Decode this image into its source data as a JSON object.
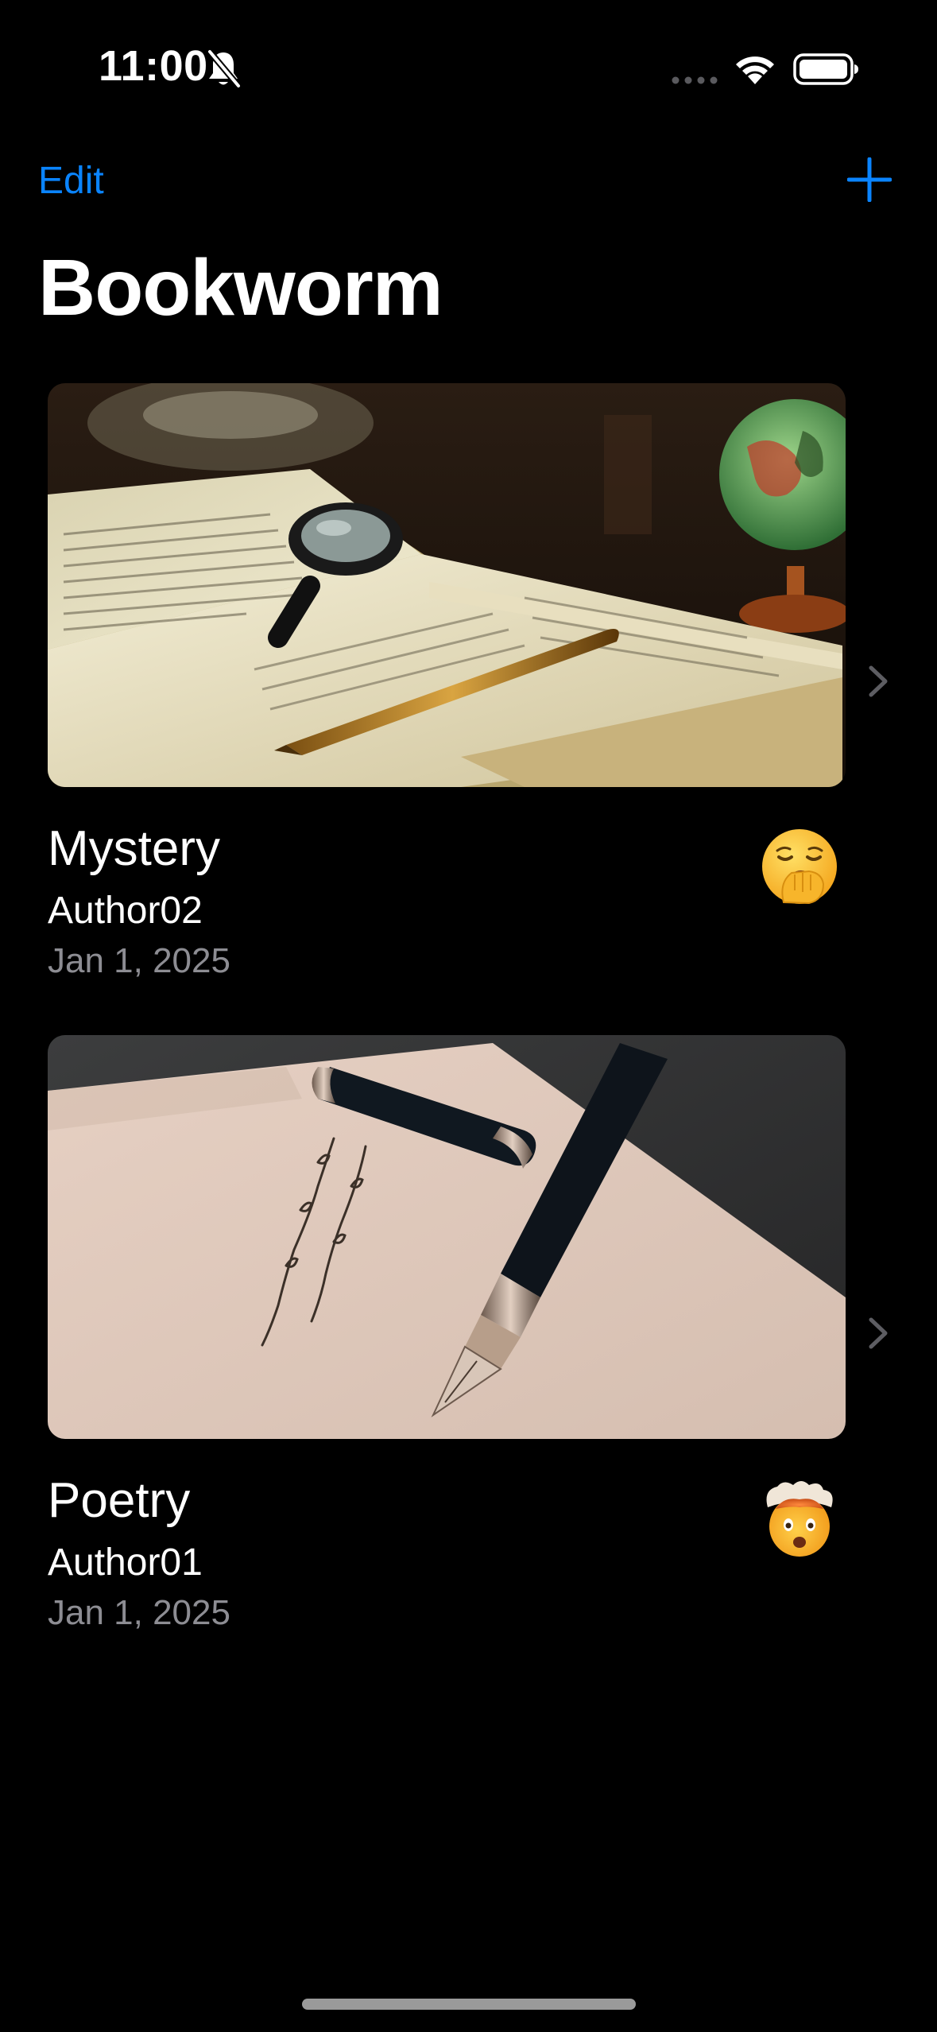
{
  "status_bar": {
    "time": "11:00",
    "icons": [
      "bell-slash-icon",
      "cellular-signal-icon",
      "wifi-icon",
      "battery-icon"
    ]
  },
  "nav": {
    "edit_label": "Edit",
    "add_icon": "plus-icon",
    "title": "Bookworm"
  },
  "colors": {
    "background": "#000000",
    "accent": "#0A84FF",
    "secondary_text": "#8D8D93"
  },
  "books": [
    {
      "title": "Mystery",
      "author": "Author02",
      "date": "Jan 1, 2025",
      "cover_icon": "magnifying-glass-book-cover-image",
      "rating_icon": "yawning-face-emoji",
      "chevron_icon": "chevron-right-icon"
    },
    {
      "title": "Poetry",
      "author": "Author01",
      "date": "Jan 1, 2025",
      "cover_icon": "fountain-pen-paper-cover-image",
      "rating_icon": "exploding-head-emoji",
      "chevron_icon": "chevron-right-icon"
    }
  ]
}
